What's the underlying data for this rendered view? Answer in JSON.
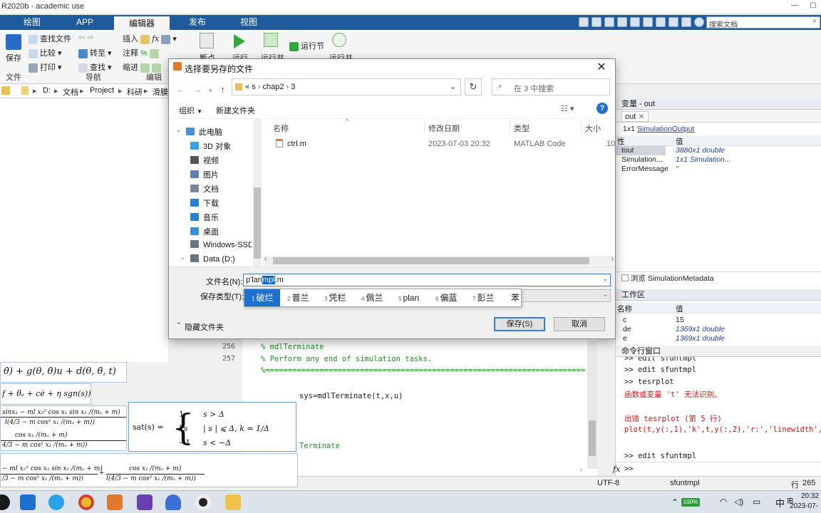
{
  "window": {
    "title": "R2020b - academic use"
  },
  "ribbon": {
    "tabs": [
      "绘图",
      "APP",
      "编辑器",
      "发布",
      "视图"
    ],
    "active_tab": "编辑器",
    "search_placeholder": "搜索文档",
    "file_group": {
      "save": "保存",
      "label": "文件",
      "find_files": "查找文件",
      "compare": "比较",
      "print": "打印"
    },
    "nav_group": {
      "goto": "转至",
      "find": "查找",
      "label": "导航"
    },
    "edit_group": {
      "insert": "插入",
      "comment": "注释",
      "indent": "缩进",
      "label": "编辑"
    },
    "breakpoint": "断点",
    "run": {
      "run": "运行",
      "run_advance": "运行并",
      "run_section": "运行节",
      "run_time": "运行并"
    }
  },
  "address": {
    "segments": [
      "D:",
      "文档",
      "Project",
      "科研",
      "滑膜"
    ]
  },
  "dialog": {
    "title": "选择要另存的文件",
    "path": [
      "«",
      "s",
      "chap2",
      "3"
    ],
    "search_placeholder": "在 3 中搜索",
    "organize": "组织",
    "new_folder": "新建文件夹",
    "nav_items": [
      {
        "label": "此电脑",
        "icon": "computer-icon",
        "color": "#4a90d9"
      },
      {
        "label": "3D 对象",
        "icon": "cube-icon",
        "color": "#3aa0e8"
      },
      {
        "label": "视频",
        "icon": "video-icon",
        "color": "#555555"
      },
      {
        "label": "图片",
        "icon": "picture-icon",
        "color": "#5a7fb5"
      },
      {
        "label": "文档",
        "icon": "document-icon",
        "color": "#7b8899"
      },
      {
        "label": "下载",
        "icon": "download-icon",
        "color": "#2a7fd4"
      },
      {
        "label": "音乐",
        "icon": "music-icon",
        "color": "#2a7fd4"
      },
      {
        "label": "桌面",
        "icon": "desktop-icon",
        "color": "#3a8fe0"
      },
      {
        "label": "Windows-SSD (",
        "icon": "drive-icon",
        "color": "#6a7380"
      },
      {
        "label": "Data (D:)",
        "icon": "drive-icon",
        "color": "#6a7380"
      }
    ],
    "columns": [
      "名称",
      "修改日期",
      "类型",
      "大小"
    ],
    "files": [
      {
        "name": "ctrl.m",
        "date": "2023-07-03 20:32",
        "type": "MATLAB Code",
        "size": "10"
      }
    ],
    "filename_label": "文件名(N):",
    "filename_parts": {
      "before": "p'lan",
      "selected": "mpl",
      "after": ".m"
    },
    "filetype_label": "保存类型(T):",
    "ime_candidates": [
      {
        "n": "1",
        "t": "破烂"
      },
      {
        "n": "2",
        "t": "普兰"
      },
      {
        "n": "3",
        "t": "凭栏"
      },
      {
        "n": "4",
        "t": "佩兰"
      },
      {
        "n": "5",
        "t": "plan"
      },
      {
        "n": "6",
        "t": "偏蓝"
      },
      {
        "n": "7",
        "t": "彭兰"
      },
      {
        "n": "",
        "t": "苯"
      }
    ],
    "hide_folders": "隐藏文件夹",
    "save_button": "保存(S)",
    "cancel_button": "取消"
  },
  "editor": {
    "lines": [
      {
        "n": "256",
        "text": "% mdlTerminate",
        "comment": true
      },
      {
        "n": "257",
        "text": "% Perform any end of simulation tasks.",
        "comment": true
      }
    ],
    "separator": "%=============================================================================",
    "call_line": "sys=mdlTerminate(t,x,u)",
    "end_comment": "Terminate"
  },
  "variables_panel": {
    "title": "变量 - out",
    "tab": "out",
    "type_label": "1x1",
    "type_link": "SimulationOutput",
    "col_property": "性",
    "col_value": "值",
    "rows": [
      {
        "name": "tout",
        "value": "3880x1 double"
      },
      {
        "name": "Simulation...",
        "value": "1x1 Simulation..."
      },
      {
        "name": "ErrorMessage",
        "value": "''"
      }
    ],
    "browse_link": "浏览 SimulationMetadata"
  },
  "workspace": {
    "title": "工作区",
    "col_name": "名称",
    "col_value": "值",
    "rows": [
      {
        "name": "c",
        "value": "15"
      },
      {
        "name": "de",
        "value": "1369x1 double"
      },
      {
        "name": "e",
        "value": "1369x1 double"
      }
    ]
  },
  "command_window": {
    "title": "命令行窗口",
    "lines": [
      {
        "kind": "cmd",
        "text": ">>  edit sfuntmpl"
      },
      {
        "kind": "cmd",
        "text": ">>  edit sfuntmpl"
      },
      {
        "kind": "cmd",
        "text": ">>  tesrplot"
      },
      {
        "kind": "err",
        "text": "函数或变量 't' 无法识别。"
      },
      {
        "kind": "blank",
        "text": ""
      },
      {
        "kind": "err",
        "text": "出错 tesrplot (第 5 行)"
      },
      {
        "kind": "err",
        "text": "plot(t,y(:,1),'k',t,y(:,2),'r:','linewidth',2)"
      },
      {
        "kind": "blank",
        "text": ""
      },
      {
        "kind": "cmd",
        "text": ">>  edit sfuntmpl"
      }
    ],
    "prompt": ">>"
  },
  "statusbar": {
    "encoding": "UTF-8",
    "file": "sfuntmpl",
    "line_label": "行",
    "line": "265"
  },
  "formulas": {
    "f1": "θ̇) + g(θ, θ̇)u + d(θ, θ̇, t)",
    "f2": "f + θ̈ₐ + cė + η sgn(s))",
    "f3a": "sinx₁ − ml x₂² cos x₁ sin x₁ /(mₒ + m)",
    "f3b": "l(4/3 − m cos² x₁ /(mₒ + m))",
    "f3c": "cos x₁ /(mₒ + m)",
    "f3d": "4/3 − m cos² x₁ /(mₒ + m))",
    "sat_lhs": "sat(s) =",
    "sat_cases": [
      {
        "v": "1",
        "c": "s > Δ"
      },
      {
        "v": "ks",
        "c": "| s | ⩽ Δ,       k = 1/Δ"
      },
      {
        "v": "−1",
        "c": "s < −Δ"
      }
    ],
    "f5a": "− ml x₂² cos x₁ sin x₁ /(mₒ + m)",
    "f5b": "/3 − m cos² x₁ /(mₒ + m))",
    "f5c": "cos x₁ /(mₒ + m)",
    "f5d": "l(4/3 − m cos² x₁ /(mₒ + m))"
  },
  "taskbar": {
    "battery": "100%",
    "ime": "中",
    "time": "20:32",
    "date": "2023-07-"
  }
}
